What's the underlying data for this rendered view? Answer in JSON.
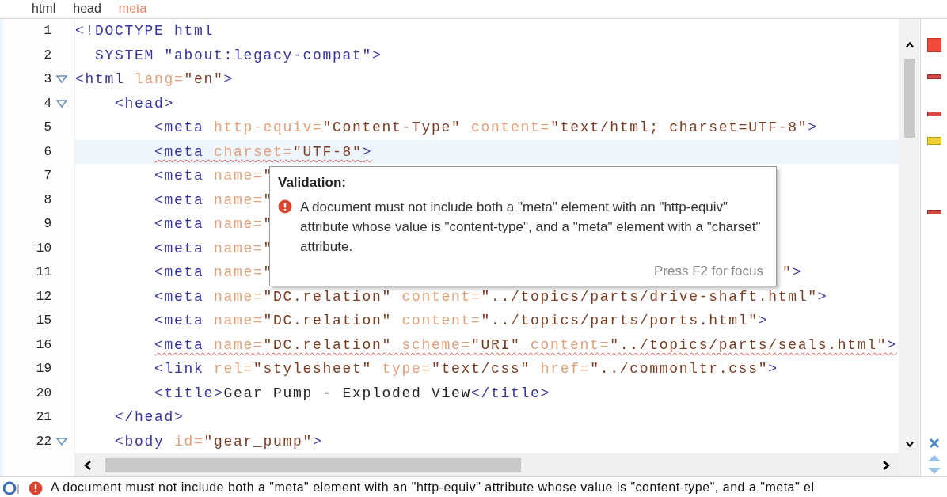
{
  "breadcrumb": [
    {
      "label": "html",
      "selected": false
    },
    {
      "label": "head",
      "selected": false
    },
    {
      "label": "meta",
      "selected": true
    }
  ],
  "editor": {
    "lines": [
      {
        "number": "1",
        "foldable": false,
        "current": false,
        "error": false,
        "tokens": [
          {
            "kind": "tag",
            "text": "<!DOCTYPE html"
          }
        ]
      },
      {
        "number": "2",
        "foldable": false,
        "current": false,
        "error": false,
        "tokens": [
          {
            "kind": "tag",
            "text": "  SYSTEM \"about:legacy-compat\">"
          }
        ]
      },
      {
        "number": "3",
        "foldable": true,
        "current": false,
        "error": false,
        "tokens": [
          {
            "kind": "tag",
            "text": "<html"
          },
          {
            "kind": "attr",
            "text": " lang="
          },
          {
            "kind": "value",
            "text": "\"en\""
          },
          {
            "kind": "tag",
            "text": ">"
          }
        ]
      },
      {
        "number": "4",
        "foldable": true,
        "current": false,
        "error": false,
        "tokens": [
          {
            "kind": "tag",
            "text": "    <head>"
          }
        ]
      },
      {
        "number": "5",
        "foldable": false,
        "current": false,
        "error": false,
        "tokens": [
          {
            "kind": "tag",
            "text": "        <meta"
          },
          {
            "kind": "attr",
            "text": " http-equiv="
          },
          {
            "kind": "value",
            "text": "\"Content-Type\""
          },
          {
            "kind": "attr",
            "text": " content="
          },
          {
            "kind": "value",
            "text": "\"text/html; charset=UTF-8\""
          },
          {
            "kind": "tag",
            "text": ">"
          }
        ]
      },
      {
        "number": "6",
        "foldable": false,
        "current": true,
        "error": true,
        "tokens": [
          {
            "kind": "tag",
            "text": "        <meta"
          },
          {
            "kind": "attr",
            "text": " charset="
          },
          {
            "kind": "value",
            "text": "\"UTF-8\""
          },
          {
            "kind": "tag",
            "text": ">"
          }
        ]
      },
      {
        "number": "7",
        "foldable": false,
        "current": false,
        "error": false,
        "tokens": [
          {
            "kind": "tag",
            "text": "        <meta"
          },
          {
            "kind": "attr",
            "text": " name="
          },
          {
            "kind": "value",
            "text": "\""
          }
        ]
      },
      {
        "number": "8",
        "foldable": false,
        "current": false,
        "error": false,
        "tokens": [
          {
            "kind": "tag",
            "text": "        <meta"
          },
          {
            "kind": "attr",
            "text": " name="
          },
          {
            "kind": "value",
            "text": "\""
          }
        ]
      },
      {
        "number": "9",
        "foldable": false,
        "current": false,
        "error": false,
        "tokens": [
          {
            "kind": "tag",
            "text": "        <meta"
          },
          {
            "kind": "attr",
            "text": " name="
          },
          {
            "kind": "value",
            "text": "\""
          }
        ]
      },
      {
        "number": "10",
        "foldable": false,
        "current": false,
        "error": false,
        "tokens": [
          {
            "kind": "tag",
            "text": "        <meta"
          },
          {
            "kind": "attr",
            "text": " name="
          },
          {
            "kind": "value",
            "text": "\""
          }
        ]
      },
      {
        "number": "11",
        "foldable": false,
        "current": false,
        "error": false,
        "tokens": [
          {
            "kind": "tag",
            "text": "        <meta"
          },
          {
            "kind": "attr",
            "text": " name="
          },
          {
            "kind": "value",
            "text": "\""
          }
        ],
        "tail": [
          {
            "kind": "value",
            "text": "\""
          },
          {
            "kind": "tag",
            "text": ">"
          }
        ]
      },
      {
        "number": "12",
        "foldable": false,
        "current": false,
        "error": false,
        "tokens": [
          {
            "kind": "tag",
            "text": "        <meta"
          },
          {
            "kind": "attr",
            "text": " name="
          },
          {
            "kind": "value",
            "text": "\"DC.relation\""
          },
          {
            "kind": "attr",
            "text": " content="
          },
          {
            "kind": "value",
            "text": "\"../topics/parts/drive-shaft.html\""
          },
          {
            "kind": "tag",
            "text": ">"
          }
        ]
      },
      {
        "number": "15",
        "foldable": false,
        "current": false,
        "error": false,
        "tokens": [
          {
            "kind": "tag",
            "text": "        <meta"
          },
          {
            "kind": "attr",
            "text": " name="
          },
          {
            "kind": "value",
            "text": "\"DC.relation\""
          },
          {
            "kind": "attr",
            "text": " content="
          },
          {
            "kind": "value",
            "text": "\"../topics/parts/ports.html\""
          },
          {
            "kind": "tag",
            "text": ">"
          }
        ]
      },
      {
        "number": "16",
        "foldable": false,
        "current": false,
        "error": true,
        "tokens": [
          {
            "kind": "tag",
            "text": "        <meta"
          },
          {
            "kind": "attr",
            "text": " name="
          },
          {
            "kind": "value",
            "text": "\"DC.relation\""
          },
          {
            "kind": "attr",
            "text": " scheme="
          },
          {
            "kind": "value",
            "text": "\"URI\""
          },
          {
            "kind": "attr",
            "text": " content="
          },
          {
            "kind": "value",
            "text": "\"../topics/parts/seals.html\""
          },
          {
            "kind": "tag",
            "text": ">"
          }
        ]
      },
      {
        "number": "19",
        "foldable": false,
        "current": false,
        "error": false,
        "tokens": [
          {
            "kind": "tag",
            "text": "        <link"
          },
          {
            "kind": "attr",
            "text": " rel="
          },
          {
            "kind": "value",
            "text": "\"stylesheet\""
          },
          {
            "kind": "attr",
            "text": " type="
          },
          {
            "kind": "value",
            "text": "\"text/css\""
          },
          {
            "kind": "attr",
            "text": " href="
          },
          {
            "kind": "value",
            "text": "\"../commonltr.css\""
          },
          {
            "kind": "tag",
            "text": ">"
          }
        ]
      },
      {
        "number": "20",
        "foldable": false,
        "current": false,
        "error": false,
        "tokens": [
          {
            "kind": "tag",
            "text": "        <title>"
          },
          {
            "kind": "text",
            "text": "Gear Pump - Exploded View"
          },
          {
            "kind": "tag",
            "text": "</title>"
          }
        ]
      },
      {
        "number": "21",
        "foldable": false,
        "current": false,
        "error": false,
        "tokens": [
          {
            "kind": "tag",
            "text": "    </head>"
          }
        ]
      },
      {
        "number": "22",
        "foldable": true,
        "current": false,
        "error": false,
        "tokens": [
          {
            "kind": "tag",
            "text": "    <body"
          },
          {
            "kind": "attr",
            "text": " id="
          },
          {
            "kind": "value",
            "text": "\"gear_pump\""
          },
          {
            "kind": "tag",
            "text": ">"
          }
        ]
      }
    ]
  },
  "tooltip": {
    "title": "Validation:",
    "message": "A document must not include both a \"meta\" element with an \"http-equiv\" attribute whose value is \"content-type\", and a \"meta\" element with a \"charset\" attribute.",
    "hint": "Press F2 for focus"
  },
  "overview_ruler": {
    "markers": [
      {
        "kind": "error"
      },
      {
        "kind": "error"
      },
      {
        "kind": "warning"
      },
      {
        "kind": "error"
      }
    ]
  },
  "problems": {
    "message": "A document must not include both a \"meta\" element with an \"http-equiv\" attribute whose value is \"content-type\", and a \"meta\" el"
  }
}
